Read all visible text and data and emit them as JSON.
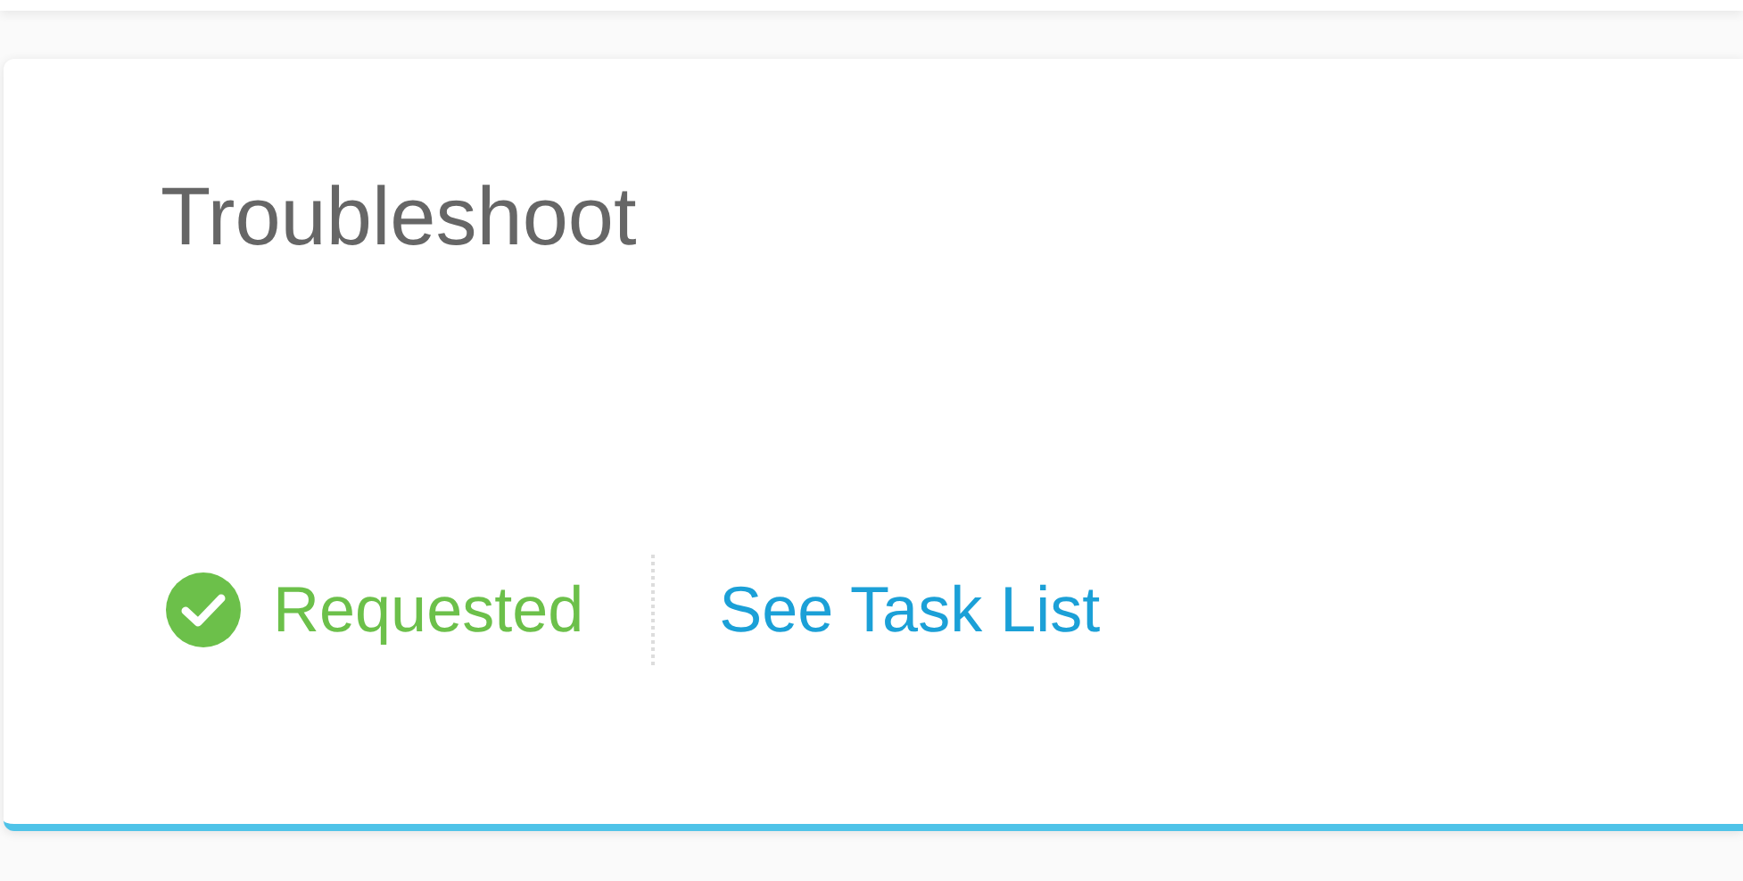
{
  "card": {
    "title": "Troubleshoot",
    "status": {
      "label": "Requested",
      "done": true
    },
    "link": "See Task List"
  }
}
